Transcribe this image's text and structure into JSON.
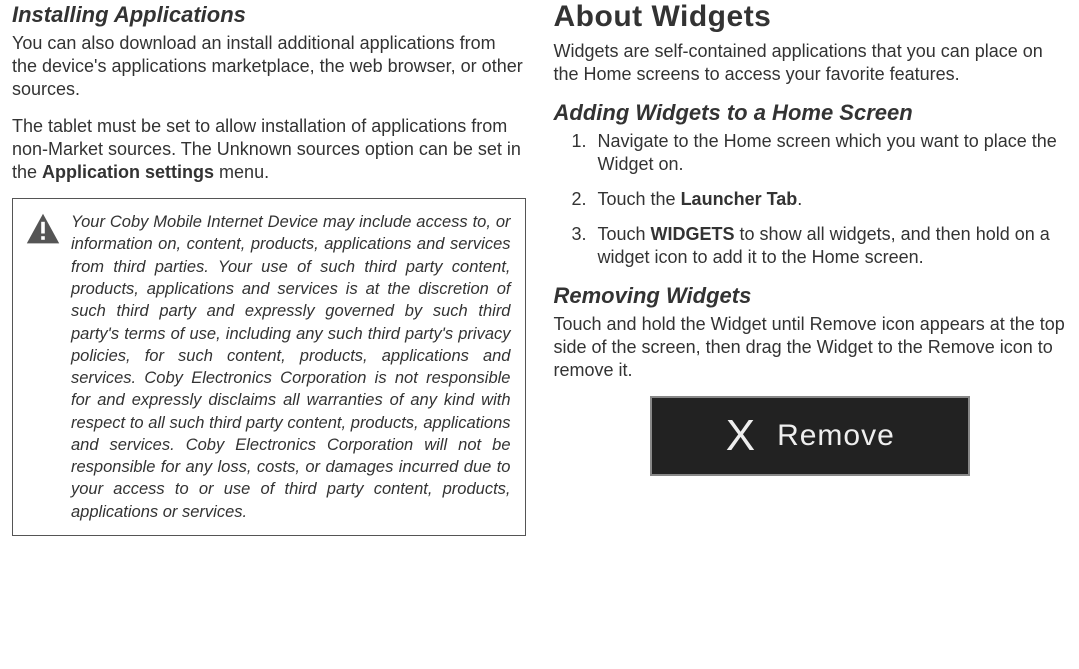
{
  "left": {
    "heading": "Installing Applications",
    "p1": "You can also download an install additional applications from the device's applications marketplace, the web browser, or other sources.",
    "p2_a": "The tablet must be set to allow installation of applications from non-Market sources. The Unknown sources option can be set in the ",
    "p2_strong": "Application settings",
    "p2_b": " menu.",
    "note": "Your Coby Mobile Internet Device may include access to, or information on, content, products, applications and services from third parties. Your use of such third party content, products, applications and services is at the discretion of such third party and expressly governed by such third party's terms of use, including any such third party's privacy policies, for such content, products, applications and services. Coby Electronics Corporation is not responsible for and expressly disclaims all warranties of any kind with respect to all such third party content, products, applications and services. Coby Electronics Corporation will not be responsible for any loss, costs, or damages incurred due to your access to or use of third party content, products, applications or services."
  },
  "right": {
    "h_main": "About Widgets",
    "p1": "Widgets are self-contained applications that you can place on the Home screens to access your favorite features.",
    "h_add": "Adding Widgets to a Home Screen",
    "li1": "Navigate to the Home screen which you want to place the Widget on.",
    "li2_a": "Touch the ",
    "li2_strong": "Launcher Tab",
    "li2_b": ".",
    "li3_a": "Touch ",
    "li3_strong": "WIDGETS",
    "li3_b": " to show all widgets, and then hold on a widget icon to add it to the Home screen.",
    "h_remove": "Removing Widgets",
    "p_remove": "Touch and hold the Widget until Remove icon appears at the top side of the screen, then drag the Widget to the Remove icon to remove it.",
    "remove_banner": {
      "x": "X",
      "label": "Remove"
    }
  }
}
